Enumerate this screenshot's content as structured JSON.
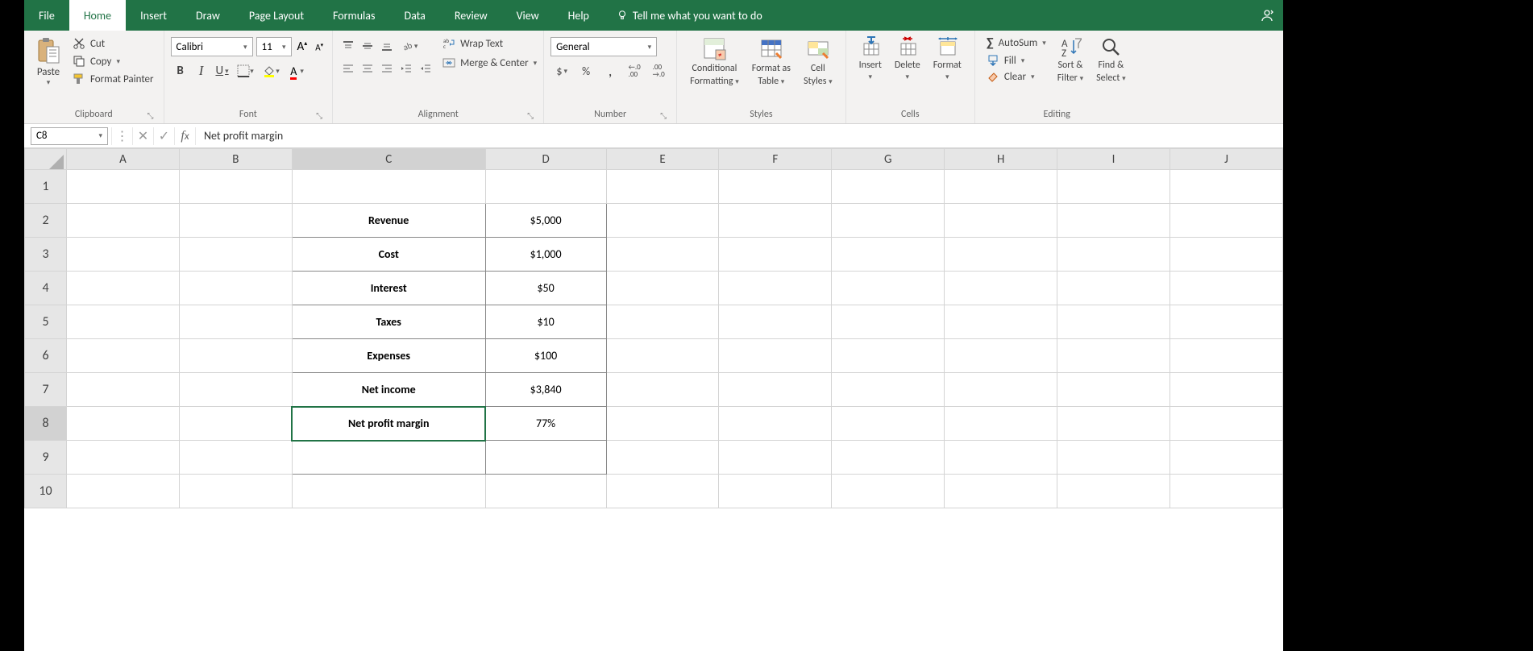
{
  "tabs": {
    "file": "File",
    "home": "Home",
    "insert": "Insert",
    "draw": "Draw",
    "pageLayout": "Page Layout",
    "formulas": "Formulas",
    "data": "Data",
    "review": "Review",
    "view": "View",
    "help": "Help"
  },
  "tellMe": "Tell me what you want to do",
  "ribbon": {
    "clipboard": {
      "paste": "Paste",
      "cut": "Cut",
      "copy": "Copy",
      "formatPainter": "Format Painter",
      "label": "Clipboard"
    },
    "font": {
      "name": "Calibri",
      "size": "11",
      "label": "Font"
    },
    "alignment": {
      "wrap": "Wrap Text",
      "merge": "Merge & Center",
      "label": "Alignment"
    },
    "number": {
      "format": "General",
      "label": "Number"
    },
    "styles": {
      "cond": "Conditional Formatting",
      "table": "Format as Table",
      "cell": "Cell Styles",
      "label": "Styles"
    },
    "cells": {
      "insert": "Insert",
      "delete": "Delete",
      "format": "Format",
      "label": "Cells"
    },
    "editing": {
      "autosum": "AutoSum",
      "fill": "Fill",
      "clear": "Clear",
      "sortFilter": "Sort & Filter",
      "findSelect": "Find & Select",
      "label": "Editing"
    }
  },
  "formulaBar": {
    "nameBox": "C8",
    "formula": "Net profit margin"
  },
  "columns": [
    "A",
    "B",
    "C",
    "D",
    "E",
    "F",
    "G",
    "H",
    "I",
    "J"
  ],
  "rows": [
    "1",
    "2",
    "3",
    "4",
    "5",
    "6",
    "7",
    "8",
    "9",
    "10"
  ],
  "sheet": {
    "C2": "Revenue",
    "D2": "$5,000",
    "C3": "Cost",
    "D3": "$1,000",
    "C4": "Interest",
    "D4": "$50",
    "C5": "Taxes",
    "D5": "$10",
    "C6": "Expenses",
    "D6": "$100",
    "C7": "Net income",
    "D7": "$3,840",
    "C8": "Net profit margin",
    "D8": "77%"
  },
  "selectedCell": "C8"
}
